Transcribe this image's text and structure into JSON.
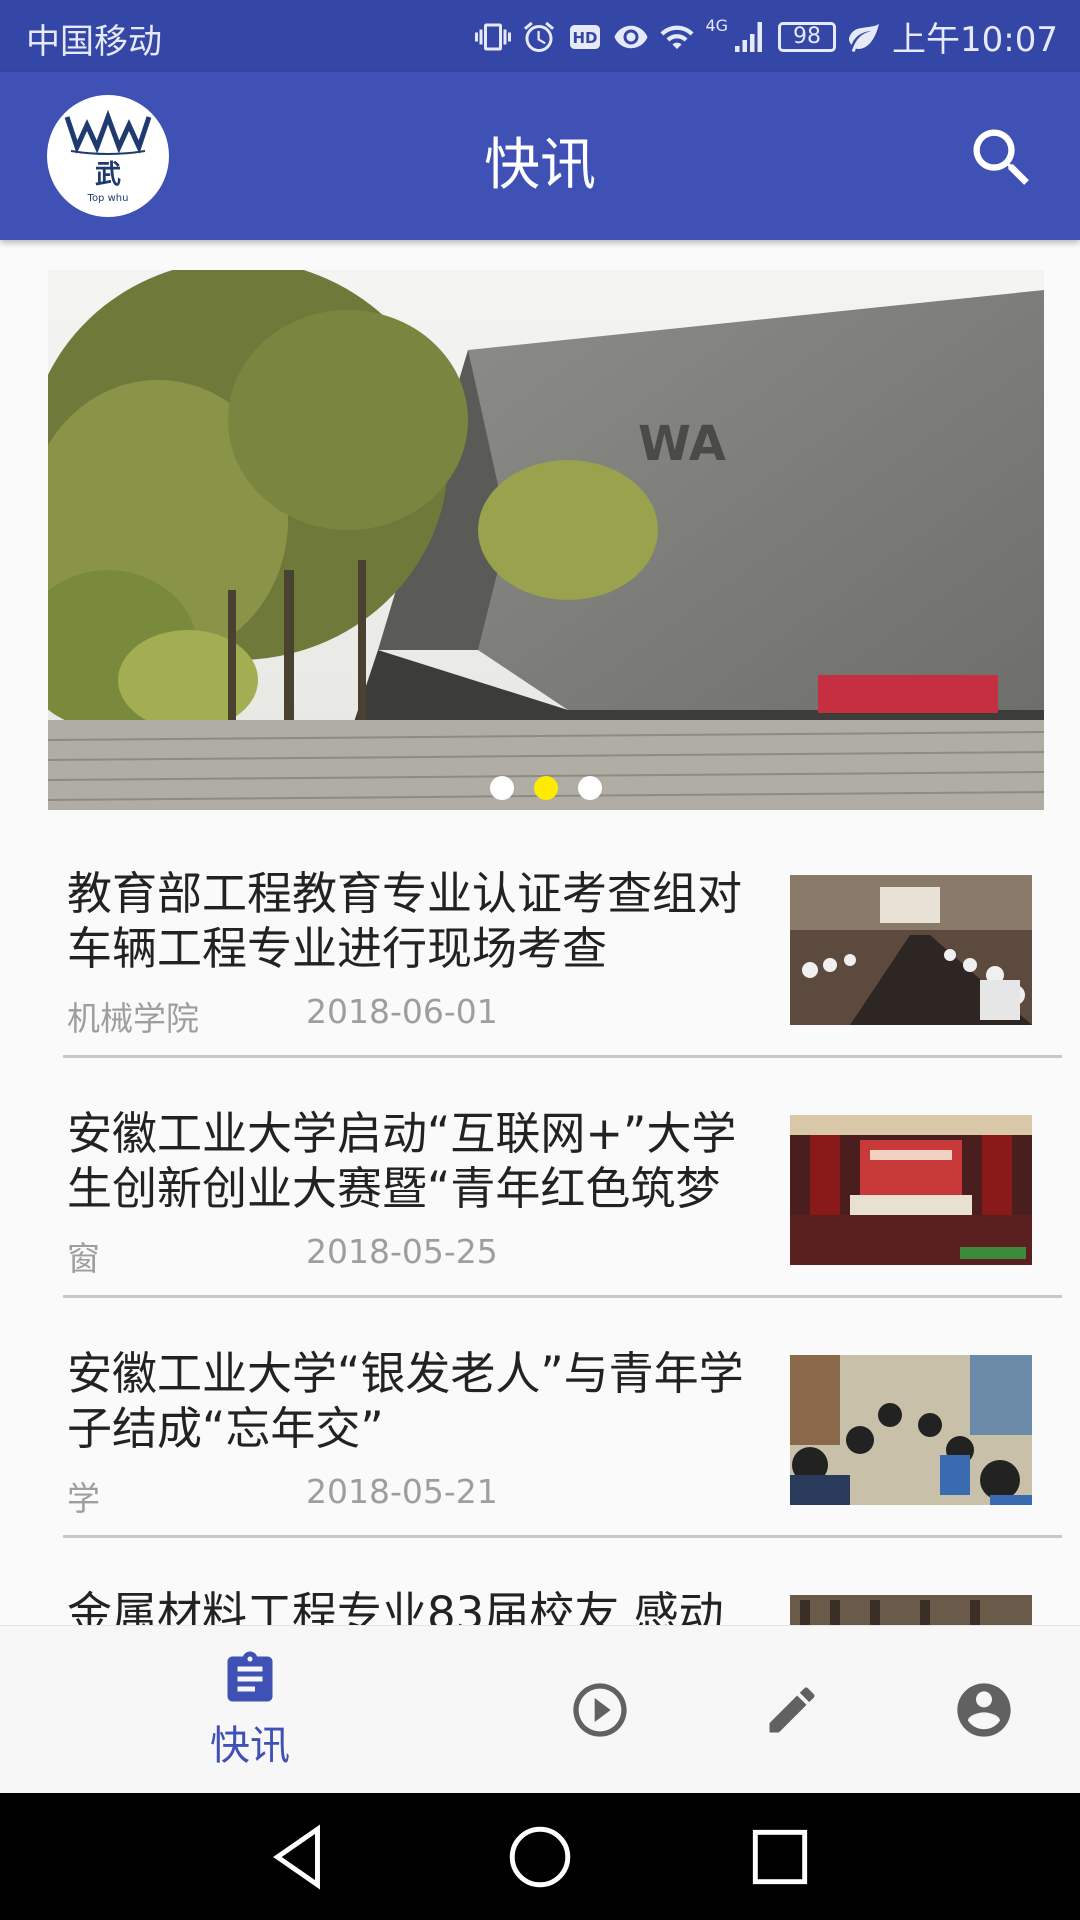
{
  "status_bar": {
    "carrier": "中国移动",
    "network": "4G",
    "battery": "98",
    "time": "上午10:07"
  },
  "app_bar": {
    "title": "快讯",
    "logo_text": "武",
    "logo_caption": "Top whu"
  },
  "banner": {
    "slides": 3,
    "active_slide": 2
  },
  "news": [
    {
      "title": "教育部工程教育专业认证考查组对车辆工程专业进行现场考查",
      "source": "机械学院",
      "date": "2018-06-01",
      "thumb": "meeting-room-photo"
    },
    {
      "title": "安徽工业大学启动“互联网+”大学生创新创业大赛暨“青年红色筑梦",
      "source": "窗",
      "date": "2018-05-25",
      "thumb": "auditorium-stage-photo"
    },
    {
      "title": "安徽工业大学“银发老人”与青年学子结成“忘年交”",
      "source": "学",
      "date": "2018-05-21",
      "thumb": "group-gathering-photo"
    },
    {
      "title": "金属材料工程专业83届校友 感动",
      "source": "",
      "date": "",
      "thumb": "bookshelf-photo"
    }
  ],
  "bottom_nav": {
    "active_label": "快讯",
    "items": [
      "clipboard-icon",
      "play-circle-icon",
      "pencil-icon",
      "account-circle-icon"
    ]
  },
  "colors": {
    "primary": "#3f51b5",
    "status_bar": "#3446a6",
    "dot_active": "#ffeb00"
  }
}
